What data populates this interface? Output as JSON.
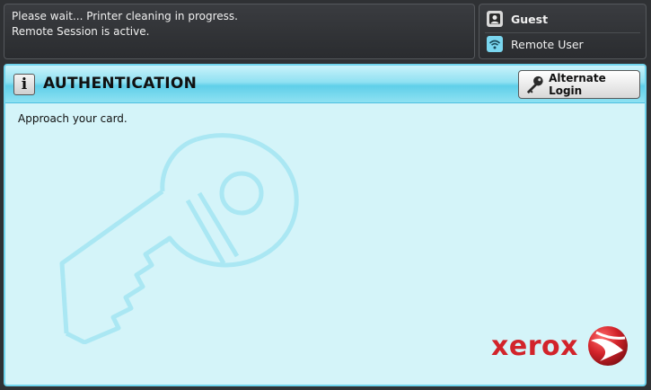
{
  "status": {
    "line1": "Please wait... Printer cleaning in progress.",
    "line2": "Remote Session is active."
  },
  "user": {
    "name": "Guest",
    "session": "Remote User"
  },
  "panel": {
    "title": "AUTHENTICATION",
    "alternate_login_label": "Alternate Login",
    "message": "Approach your card."
  },
  "branding": {
    "logo_text": "xerox",
    "brand_color": "#d2232a"
  },
  "colors": {
    "panel_bg": "#d4f4f9",
    "accent": "#6fd3ec"
  }
}
